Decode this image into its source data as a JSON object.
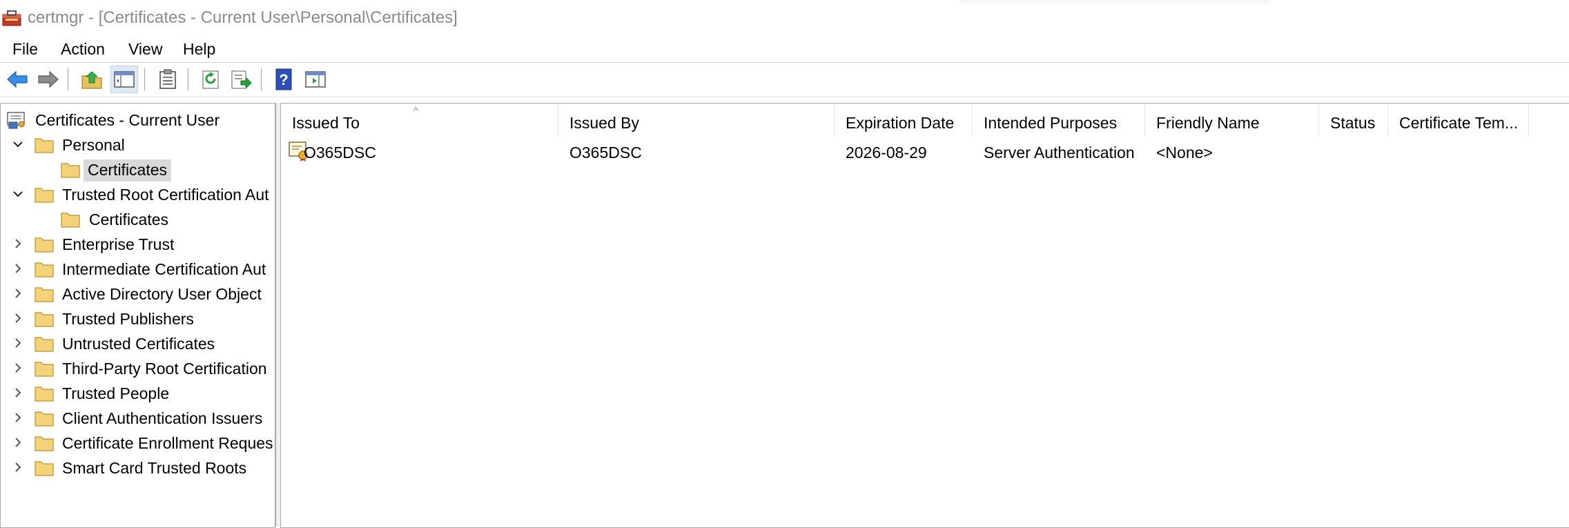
{
  "window": {
    "title": "certmgr - [Certificates - Current User\\Personal\\Certificates]",
    "app_icon": "certmgr-toolbox-icon"
  },
  "menu": {
    "items": [
      "File",
      "Action",
      "View",
      "Help"
    ]
  },
  "toolbar": {
    "buttons": [
      "back-icon",
      "forward-icon",
      "up-one-level-icon",
      "show-hide-console-tree-icon",
      "properties-icon",
      "refresh-icon",
      "export-list-icon",
      "help-icon",
      "action-pane-icon"
    ],
    "pressed": "show-hide-console-tree-icon"
  },
  "tree": {
    "root": "Certificates - Current User",
    "items": [
      {
        "label": "Personal",
        "expanded": true
      },
      {
        "label": "Certificates",
        "child": true,
        "selected": true
      },
      {
        "label": "Trusted Root Certification Aut",
        "expanded": true
      },
      {
        "label": "Certificates",
        "child": true
      },
      {
        "label": "Enterprise Trust"
      },
      {
        "label": "Intermediate Certification Aut"
      },
      {
        "label": "Active Directory User Object"
      },
      {
        "label": "Trusted Publishers"
      },
      {
        "label": "Untrusted Certificates"
      },
      {
        "label": "Third-Party Root Certification"
      },
      {
        "label": "Trusted People"
      },
      {
        "label": "Client Authentication Issuers"
      },
      {
        "label": "Certificate Enrollment Reques"
      },
      {
        "label": "Smart Card Trusted Roots"
      }
    ]
  },
  "list": {
    "columns": [
      "Issued To",
      "Issued By",
      "Expiration Date",
      "Intended Purposes",
      "Friendly Name",
      "Status",
      "Certificate Tem..."
    ],
    "sort_indicator": "^",
    "rows": [
      {
        "issued_to": "O365DSC",
        "issued_by": "O365DSC",
        "expiration_date": "2026-08-29",
        "intended_purposes": "Server Authentication",
        "friendly_name": "<None>",
        "status": "",
        "certificate_template": ""
      }
    ]
  }
}
